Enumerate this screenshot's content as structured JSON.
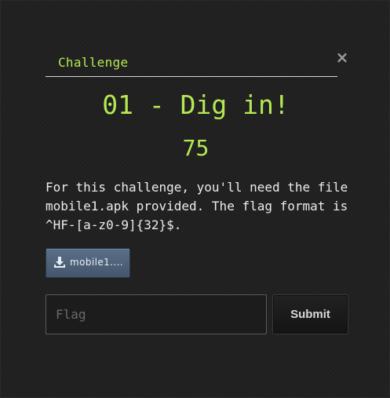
{
  "modal": {
    "tab_label": "Challenge",
    "close_glyph": "×",
    "title": "01 - Dig in!",
    "points": "75",
    "description": "For this challenge, you'll need the file\nmobile1.apk provided. The flag format is\n^HF-[a-z0-9]{32}$.",
    "file": {
      "label": "mobile1....",
      "icon": "download-icon"
    },
    "flag_input": {
      "value": "",
      "placeholder": "Flag"
    },
    "submit_label": "Submit"
  },
  "colors": {
    "accent": "#b5e853",
    "background": "#202020",
    "text": "#ececec",
    "file_button": "#4f6279"
  }
}
